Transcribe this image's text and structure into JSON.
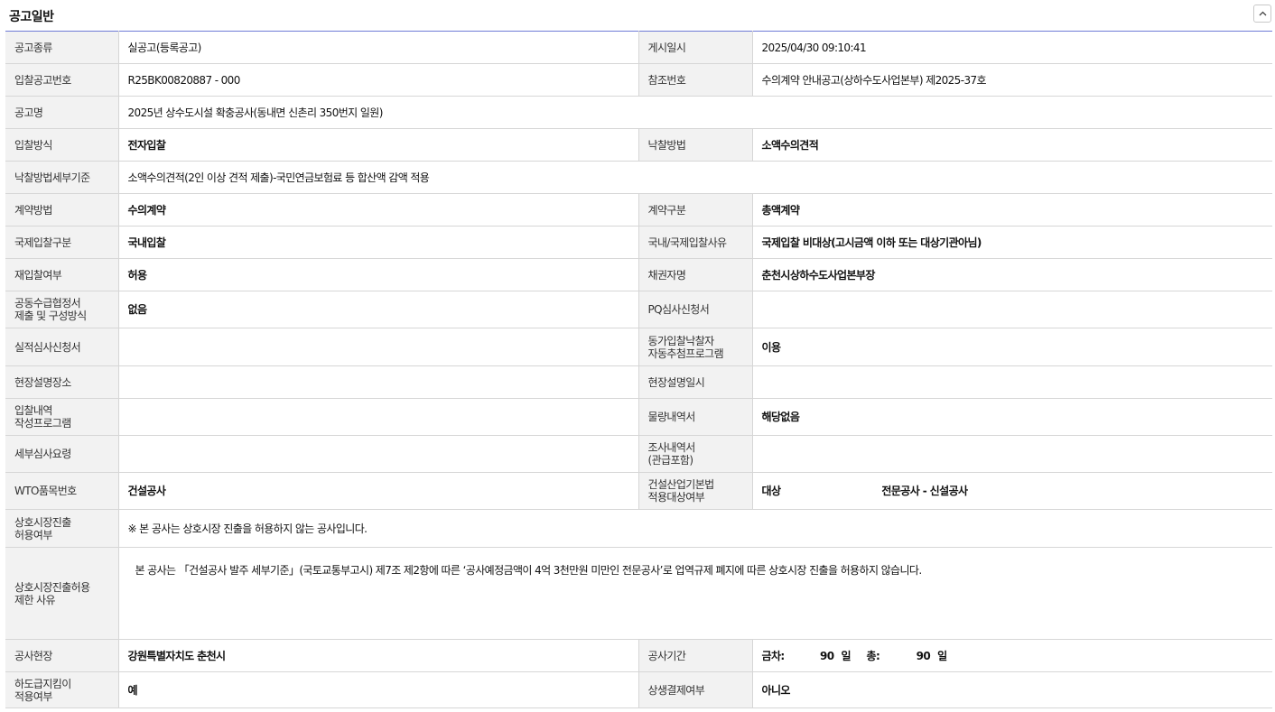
{
  "section": {
    "title": "공고일반"
  },
  "rows": {
    "notice_type": {
      "label": "공고종류",
      "value": "실공고(등록공고)"
    },
    "posted_at": {
      "label": "게시일시",
      "value": "2025/04/30 09:10:41"
    },
    "bid_no": {
      "label": "입찰공고번호",
      "value": "R25BK00820887 - 000"
    },
    "ref_no": {
      "label": "참조번호",
      "value": "수의계약 안내공고(상하수도사업본부) 제2025-37호"
    },
    "notice_name": {
      "label": "공고명",
      "value": "2025년 상수도시설 확충공사(동내면 신촌리 350번지 일원)"
    },
    "bid_method": {
      "label": "입찰방식",
      "value": "전자입찰"
    },
    "award_method": {
      "label": "낙찰방법",
      "value": "소액수의견적"
    },
    "award_criteria": {
      "label": "낙찰방법세부기준",
      "value": "소액수의견적(2인 이상 견적 제출)-국민연금보험료 등 합산액 감액 적용"
    },
    "contract_method": {
      "label": "계약방법",
      "value": "수의계약"
    },
    "contract_type": {
      "label": "계약구분",
      "value": "총액계약"
    },
    "intl_type": {
      "label": "국제입찰구분",
      "value": "국내입찰"
    },
    "intl_reason": {
      "label": "국내/국제입찰사유",
      "value": "국제입찰 비대상(고시금액 이하 또는 대상기관아님)"
    },
    "rebid": {
      "label": "재입찰여부",
      "value": "허용"
    },
    "creditor": {
      "label": "채권자명",
      "value": "춘천시상하수도사업본부장"
    },
    "joint_supply": {
      "label_line1": "공동수급협정서",
      "label_line2": "제출 및 구성방식",
      "value": "없음"
    },
    "pq": {
      "label": "PQ심사신청서",
      "value": ""
    },
    "performance_review": {
      "label": "실적심사신청서",
      "value": ""
    },
    "tie_lottery": {
      "label_line1": "동가입찰낙찰자",
      "label_line2": "자동추첨프로그램",
      "value": "이용"
    },
    "site_place": {
      "label": "현장설명장소",
      "value": ""
    },
    "site_datetime": {
      "label": "현장설명일시",
      "value": ""
    },
    "bid_program": {
      "label_line1": "입찰내역",
      "label_line2": "작성프로그램",
      "value": ""
    },
    "quantity": {
      "label": "물량내역서",
      "value": "해당없음"
    },
    "review_guide": {
      "label": "세부심사요령",
      "value": ""
    },
    "survey": {
      "label_line1": "조사내역서",
      "label_line2": "(관급포함)",
      "value": ""
    },
    "wto": {
      "label": "WTO품목번호",
      "value": "건설공사"
    },
    "construction_law": {
      "label_line1": "건설산업기본법",
      "label_line2": "적용대상여부",
      "value": "대상",
      "value2": "전문공사 - 신설공사"
    },
    "mutual_entry": {
      "label_line1": "상호시장진출",
      "label_line2": "허용여부",
      "value": "※ 본 공사는 상호시장 진출을 허용하지 않는 공사입니다."
    },
    "mutual_restrict": {
      "label_line1": "상호시장진출허용",
      "label_line2": "제한 사유",
      "value": "본 공사는 「건설공사 발주 세부기준」(국토교통부고시) 제7조 제2항에 따른 ‘공사예정금액이 4억 3천만원 미만인 전문공사’로 업역규제 폐지에 따른 상호시장 진출을 허용하지 않습니다."
    },
    "site": {
      "label": "공사현장",
      "value": "강원특별자치도 춘천시"
    },
    "period": {
      "label": "공사기간",
      "this_label": "금차:",
      "this_days": "90",
      "unit": "일",
      "total_label": "총:",
      "total_days": "90"
    },
    "subcontract": {
      "label_line1": "하도급지킴이",
      "label_line2": "적용여부",
      "value": "예"
    },
    "settlement": {
      "label": "상생결제여부",
      "value": "아니오"
    }
  }
}
